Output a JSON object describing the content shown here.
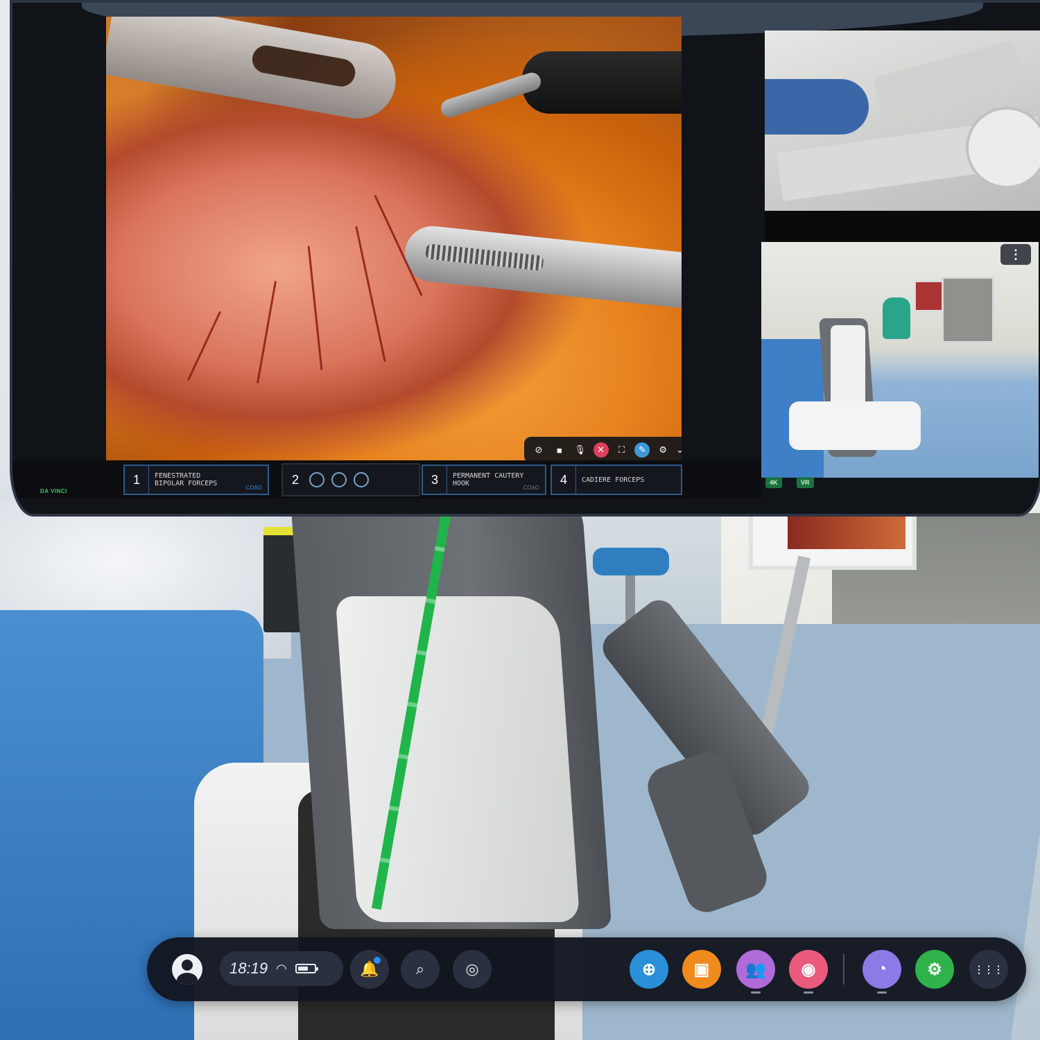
{
  "surgical_view": {
    "hud": {
      "brand": "DA VINCI",
      "instruments": [
        {
          "num": "1",
          "name_line1": "FENESTRATED",
          "name_line2": "BIPOLAR FORCEPS",
          "tag": "COAG"
        },
        {
          "num": "2",
          "name_line1": "",
          "name_line2": "",
          "tag": ""
        },
        {
          "num": "3",
          "name_line1": "PERMANENT CAUTERY",
          "name_line2": "HOOK",
          "tag": "COAG"
        },
        {
          "num": "4",
          "name_line1": "CADIERE FORCEPS",
          "name_line2": "",
          "tag": ""
        }
      ]
    },
    "controls": {
      "icons": [
        "no-entry-icon",
        "camera-icon",
        "microphone-icon",
        "mic-muted-icon",
        "fullscreen-icon",
        "pen-icon",
        "settings-icon",
        "chevron-down-icon"
      ]
    }
  },
  "side_panels": {
    "menu_glyph": "⋮",
    "badges": [
      "4K",
      "VR"
    ]
  },
  "dock": {
    "time": "18:19",
    "notification_dot_color": "#2f8ff0",
    "apps": [
      {
        "name": "navigator",
        "color": "#2a8fd6",
        "glyph": "⊕"
      },
      {
        "name": "store",
        "color": "#f08a1c",
        "glyph": "▣"
      },
      {
        "name": "people",
        "color": "#b06ad9",
        "glyph": "👥"
      },
      {
        "name": "camera",
        "color": "#ea5a7d",
        "glyph": "◉"
      },
      {
        "name": "browser",
        "color": "#8c7ae6",
        "glyph": "◔"
      },
      {
        "name": "settings",
        "color": "#2fb24a",
        "glyph": "⚙"
      },
      {
        "name": "app-library",
        "color": "#2a3040",
        "glyph": "⋮⋮⋮"
      }
    ]
  }
}
